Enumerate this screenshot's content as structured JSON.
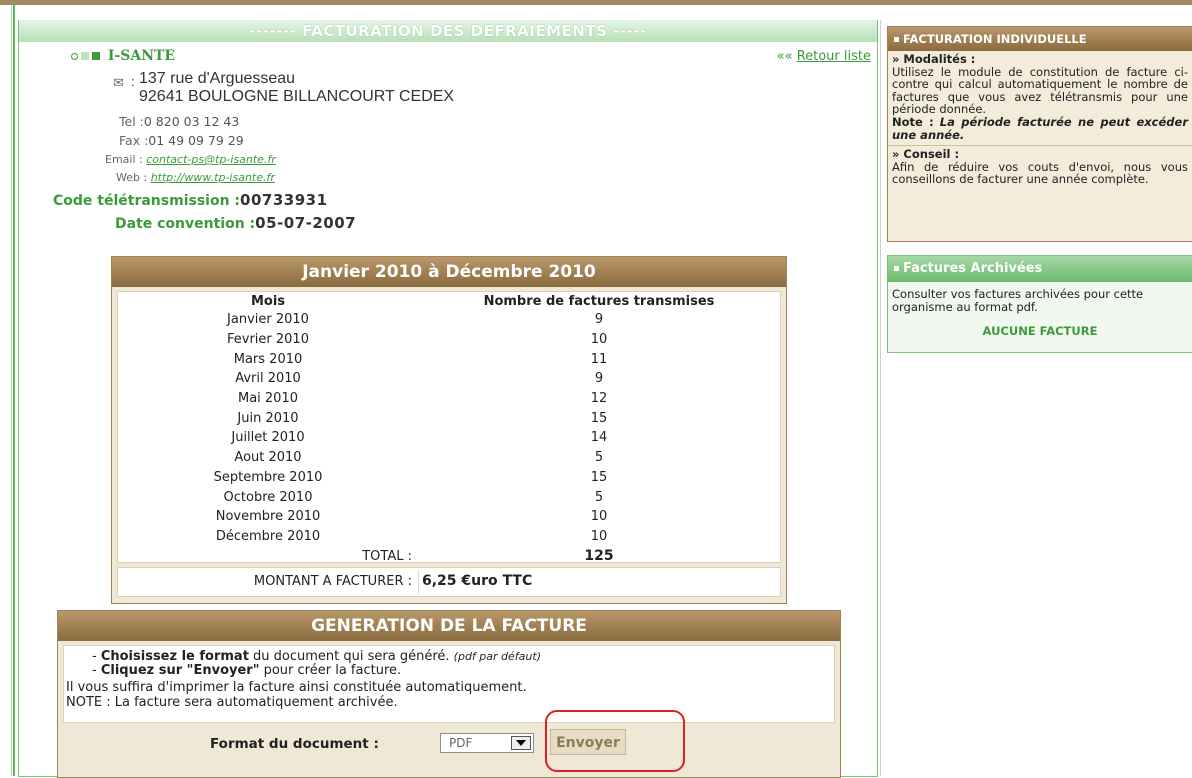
{
  "main": {
    "header": "------- FACTURATION DES DEFRAIEMENTS -----",
    "org_name": "I-SANTE",
    "retour_label": "«« ",
    "retour_link": "Retour liste",
    "address_line1": "137 rue d'Arguesseau",
    "address_line2": "92641 BOULOGNE BILLANCOURT CEDEX",
    "envelope_suffix": ":",
    "tel_label": "Tel :",
    "tel": "0 820 03 12 43",
    "fax_label": "Fax :",
    "fax": "01 49 09 79 29",
    "email_label": "Email :",
    "email": "contact-ps@tp-isante.fr",
    "web_label": "Web :",
    "web": "http://www.tp-isante.fr",
    "code_label": "Code télétransmission :",
    "code_value": "00733931",
    "date_label": "Date convention :",
    "date_value": "05-07-2007"
  },
  "table": {
    "title": "Janvier 2010 à Décembre 2010",
    "col_mois": "Mois",
    "col_nombre": "Nombre de factures transmises",
    "rows": [
      {
        "mois": "Janvier 2010",
        "n": "9"
      },
      {
        "mois": "Fevrier 2010",
        "n": "10"
      },
      {
        "mois": "Mars 2010",
        "n": "11"
      },
      {
        "mois": "Avril 2010",
        "n": "9"
      },
      {
        "mois": "Mai 2010",
        "n": "12"
      },
      {
        "mois": "Juin 2010",
        "n": "15"
      },
      {
        "mois": "Juillet 2010",
        "n": "14"
      },
      {
        "mois": "Aout 2010",
        "n": "5"
      },
      {
        "mois": "Septembre 2010",
        "n": "15"
      },
      {
        "mois": "Octobre 2010",
        "n": "5"
      },
      {
        "mois": "Novembre 2010",
        "n": "10"
      },
      {
        "mois": "Décembre 2010",
        "n": "10"
      }
    ],
    "total_label": "TOTAL :",
    "total_value": "125",
    "montant_label": "MONTANT A FACTURER :",
    "montant_value": "6,25 €uro TTC"
  },
  "generation": {
    "title": "GENERATION DE LA FACTURE",
    "line1_bold": "Choisissez le format",
    "line1_rest": " du document qui sera généré.",
    "line1_note": "(pdf par défaut)",
    "line2_bold": "Cliquez sur \"Envoyer\"",
    "line2_rest": " pour créer la facture.",
    "line3": "Il vous suffira d'imprimer la facture ainsi constituée automatiquement.",
    "line4": "NOTE : La facture sera automatiquement archivée.",
    "format_label": "Format du document :",
    "format_value": "PDF",
    "send_label": "Envoyer"
  },
  "sidebar": {
    "panel1_title": "FACTURATION INDIVIDUELLE",
    "modalites_title": "» Modalités :",
    "modalites_text": "Utilisez le module de constitution de facture ci-contre qui calcul automatiquement le nombre de factures que vous avez télétransmis pour une période donnée.",
    "note_label": "Note :",
    "note_text": "La période facturée ne peut excéder une année.",
    "conseil_title": "» Conseil :",
    "conseil_text": "Afin de réduire vos couts d'envoi, nous vous conseillons de facturer une année complète.",
    "panel2_title": "Factures Archivées",
    "panel2_text": "Consulter vos factures archivées pour cette organisme au format pdf.",
    "panel2_none": "AUCUNE FACTURE"
  },
  "colors": {
    "green": "#3b9a3b",
    "brown": "#8a6b3e",
    "highlight": "#e02020"
  }
}
